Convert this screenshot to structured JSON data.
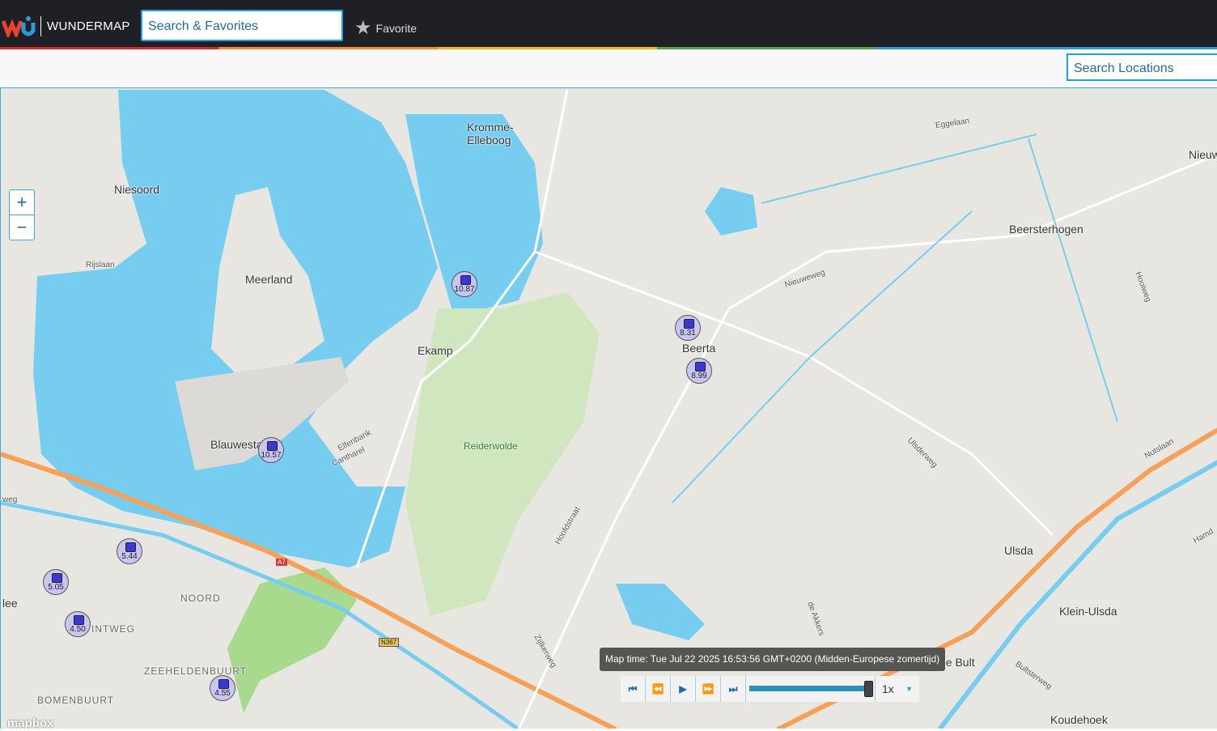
{
  "header": {
    "brand": "WUNDERMAP",
    "search_placeholder": "Search & Favorites",
    "favorite_label": "Favorite"
  },
  "subbar": {
    "location_search_placeholder": "Search Locations"
  },
  "map": {
    "places": [
      {
        "name": "Kromme-\nElleboog",
        "id": "kromme"
      },
      {
        "name": "Niesoord"
      },
      {
        "name": "Meerland"
      },
      {
        "name": "Ekamp"
      },
      {
        "name": "Beerta"
      },
      {
        "name": "Blauwestad"
      },
      {
        "name": "Beersterhogen"
      },
      {
        "name": "Ulsda"
      },
      {
        "name": "Klein-Ulsda"
      },
      {
        "name": "Koudehoek"
      },
      {
        "name": "Reiderwolde"
      },
      {
        "name": "NOORD"
      },
      {
        "name": "ZEEHELDENBUURT"
      },
      {
        "name": "BOMENBUURT"
      },
      {
        "name": "INTWEG"
      },
      {
        "name": "lee"
      },
      {
        "name": "Nieuw"
      },
      {
        "name": "de Bult"
      }
    ],
    "roads": [
      "Eggelaan",
      "Rijslaan",
      "Nieuweweg",
      "Elfenbank",
      "Cantharel",
      "Hoofdstraat",
      "Ulsderweg",
      "Nutslaan",
      "Hooiweg",
      "Zijlkerweg",
      "de Akkers",
      "Bultsterweg",
      "Hamd",
      "weg",
      "A7",
      "N367"
    ],
    "stations": [
      "10.87",
      "8.31",
      "8.99",
      "10.57",
      "5.44",
      "5.05",
      "4.50",
      "4.55"
    ],
    "attribution": "mapbox"
  },
  "zoom": {
    "in": "+",
    "out": "−"
  },
  "player": {
    "map_time": "Map time: Tue Jul 22 2025 16:53:56 GMT+0200 (Midden-Europese zomertijd)",
    "speed": "1x",
    "progress": 1.0,
    "buttons": {
      "first": "⏮",
      "back": "⏪",
      "play": "▶",
      "forward": "⏩",
      "last": "⏭"
    }
  }
}
